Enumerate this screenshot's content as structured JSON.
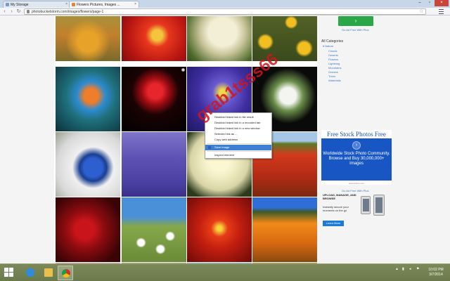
{
  "browser": {
    "tabs": [
      {
        "title": "My Storage"
      },
      {
        "title": "Flowers Pictures, Images ..."
      }
    ],
    "url": "photobucketstorm.com/images/flowers/page-1"
  },
  "context_menu": {
    "items": [
      {
        "label": "Deskfold linked link in file result"
      },
      {
        "label": "Deskfold linked link in a recorded tab"
      },
      {
        "label": "Deskfold linked link in a new window"
      },
      {
        "label": "Selected link as ..."
      },
      {
        "label": "Copy web address"
      },
      {
        "label": "Save Image"
      },
      {
        "label": "Inspect element"
      }
    ]
  },
  "watermark": "grab1tsss66",
  "sidebar": {
    "download_button": "›",
    "go_ad_free_1": "Go Ad Free With Plus",
    "all_categories": "All Categories",
    "categories": [
      "Nature",
      "Clouds",
      "Deserts",
      "Flowers",
      "Lightning",
      "Mountains",
      "Oceans",
      "Trees",
      "Waterfalls"
    ],
    "ad1": {
      "title": "Free Stock Photos Free",
      "text": "Worldwide Stock Photo Community. Browse and Buy 30,000,000+ Images",
      "url": "dreamstime.com",
      "arrow": "›"
    },
    "go_ad_free_2": "Go Ad Free With Plus",
    "ad2": {
      "headline": "UPLOAD, MANAGE, AND BROWSE",
      "subtext": "Instantly secure your moments on the go",
      "button": "Learn More"
    }
  },
  "taskbar": {
    "time": "10:02 PM",
    "date": "3/7/2014"
  },
  "colors": {
    "accent_green": "#2aa848",
    "link_blue": "#3b78c6",
    "ad_blue": "#1856c4",
    "close_red": "#c9473a"
  }
}
